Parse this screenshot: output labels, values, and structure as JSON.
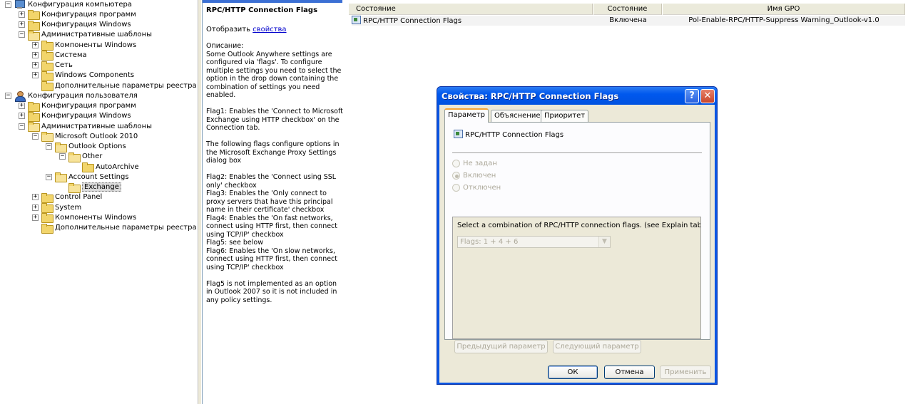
{
  "tree": {
    "items": [
      {
        "label": "Конфигурация компьютера",
        "icon": "computer-icon",
        "level": 0,
        "expander": "−"
      },
      {
        "label": "Конфигурация программ",
        "icon": "folder-icon",
        "level": 1,
        "expander": "+"
      },
      {
        "label": "Конфигурация Windows",
        "icon": "folder-icon",
        "level": 1,
        "expander": "+"
      },
      {
        "label": "Административные шаблоны",
        "icon": "folder-open-icon",
        "level": 1,
        "expander": "−"
      },
      {
        "label": "Компоненты Windows",
        "icon": "folder-icon",
        "level": 2,
        "expander": "+"
      },
      {
        "label": "Система",
        "icon": "folder-icon",
        "level": 2,
        "expander": "+"
      },
      {
        "label": "Сеть",
        "icon": "folder-icon",
        "level": 2,
        "expander": "+"
      },
      {
        "label": "Windows Components",
        "icon": "folder-icon",
        "level": 2,
        "expander": "+"
      },
      {
        "label": "Дополнительные параметры реестра",
        "icon": "folder-icon",
        "level": 2,
        "expander": ""
      },
      {
        "label": "Конфигурация пользователя",
        "icon": "user-icon",
        "level": 0,
        "expander": "−"
      },
      {
        "label": "Конфигурация программ",
        "icon": "folder-icon",
        "level": 1,
        "expander": "+"
      },
      {
        "label": "Конфигурация Windows",
        "icon": "folder-icon",
        "level": 1,
        "expander": "+"
      },
      {
        "label": "Административные шаблоны",
        "icon": "folder-open-icon",
        "level": 1,
        "expander": "−"
      },
      {
        "label": "Microsoft Outlook 2010",
        "icon": "folder-open-icon",
        "level": 2,
        "expander": "−"
      },
      {
        "label": "Outlook Options",
        "icon": "folder-open-icon",
        "level": 3,
        "expander": "−"
      },
      {
        "label": "Other",
        "icon": "folder-open-icon",
        "level": 4,
        "expander": "−"
      },
      {
        "label": "AutoArchive",
        "icon": "folder-icon",
        "level": 5,
        "expander": ""
      },
      {
        "label": "Account Settings",
        "icon": "folder-open-icon",
        "level": 3,
        "expander": "−"
      },
      {
        "label": "Exchange",
        "icon": "folder-open-icon",
        "level": 4,
        "expander": "",
        "selected": true
      },
      {
        "label": "Control Panel",
        "icon": "folder-icon",
        "level": 2,
        "expander": "+"
      },
      {
        "label": "System",
        "icon": "folder-icon",
        "level": 2,
        "expander": "+"
      },
      {
        "label": "Компоненты Windows",
        "icon": "folder-icon",
        "level": 2,
        "expander": "+"
      },
      {
        "label": "Дополнительные параметры реестра",
        "icon": "folder-icon",
        "level": 2,
        "expander": ""
      }
    ]
  },
  "explain": {
    "title": "RPC/HTTP Connection Flags",
    "show_prefix": "Отобразить",
    "show_link": "свойства ",
    "description": "Описание:\nSome Outlook Anywhere settings are configured via 'flags'. To configure multiple settings you need to select the option in the drop down containing the combination of settings you need enabled.\n\nFlag1: Enables the 'Connect to Microsoft Exchange using HTTP checkbox' on the Connection tab.\n\nThe following flags configure options in the Microsoft Exchange Proxy Settings dialog box\n\nFlag2: Enables the 'Connect using SSL only' checkbox\nFlag3: Enables the 'Only connect to proxy servers that have this principal name in their certificate' checkbox\nFlag4: Enables the 'On fast networks, connect using HTTP first, then connect using TCP/IP' checkbox\nFlag5: see below\nFlag6: Enables the 'On slow networks, connect using HTTP first, then connect using TCP/IP' checkbox\n\nFlag5 is not implemented as an option in Outlook 2007 so it is not included in any policy settings."
  },
  "list": {
    "columns": [
      "Состояние",
      "Состояние",
      "Имя GPO"
    ],
    "rows": [
      {
        "setting": "RPC/HTTP Connection Flags",
        "state": "Включена",
        "gpo": "Pol-Enable-RPC/HTTP-Suppress Warning_Outlook-v1.0"
      }
    ]
  },
  "dialog": {
    "title": "Свойства: RPC/HTTP Connection Flags",
    "help": "?",
    "close": "✕",
    "tabs": [
      "Параметр",
      "Объяснение",
      "Приоритет"
    ],
    "setting_name": "RPC/HTTP Connection Flags",
    "radios": [
      {
        "label": "Не задан",
        "checked": false
      },
      {
        "label": "Включен",
        "checked": true
      },
      {
        "label": "Отключен",
        "checked": false
      }
    ],
    "options_text": "Select a combination of RPC/HTTP connection flags. (see Explain tab for",
    "combo_value": "Flags: 1 + 4 + 6",
    "prev_button": "Предыдущий параметр",
    "next_button": "Следующий параметр",
    "ok": "ОК",
    "cancel": "Отмена",
    "apply": "Применить"
  }
}
